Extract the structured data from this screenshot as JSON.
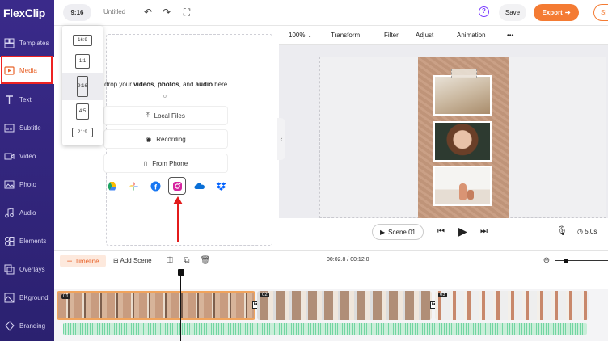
{
  "app": {
    "logo": "FlexClip"
  },
  "topbar": {
    "ratio": "9:16",
    "title": "Untitled",
    "save_label": "Save",
    "export_label": "Export",
    "signin_label": "Si"
  },
  "sidebar": {
    "items": [
      {
        "label": "Templates",
        "icon": "templates-icon"
      },
      {
        "label": "Media",
        "icon": "media-icon",
        "active": true
      },
      {
        "label": "Text",
        "icon": "text-icon"
      },
      {
        "label": "Subtitle",
        "icon": "subtitle-icon"
      },
      {
        "label": "Video",
        "icon": "video-icon"
      },
      {
        "label": "Photo",
        "icon": "photo-icon"
      },
      {
        "label": "Audio",
        "icon": "audio-icon"
      },
      {
        "label": "Elements",
        "icon": "elements-icon"
      },
      {
        "label": "Overlays",
        "icon": "overlays-icon"
      },
      {
        "label": "BKground",
        "icon": "background-icon"
      },
      {
        "label": "Branding",
        "icon": "branding-icon"
      }
    ]
  },
  "ratio_menu": {
    "options": [
      "16:9",
      "1:1",
      "9:16",
      "4:5",
      "21:9"
    ],
    "selected": "9:16"
  },
  "media": {
    "drop_prefix": "nd drop your",
    "drop_videos": "videos",
    "drop_photos": "photos",
    "drop_and": ", and",
    "drop_audio": "audio",
    "drop_suffix": "here.",
    "or": "or",
    "local_files": "Local Files",
    "recording": "Recording",
    "from_phone": "From Phone",
    "cloud_sources": [
      "google-drive-icon",
      "google-photos-icon",
      "facebook-icon",
      "instagram-icon",
      "onedrive-icon",
      "dropbox-icon"
    ]
  },
  "editor_toolbar": {
    "zoom": "100%",
    "transform": "Transform",
    "filter": "Filter",
    "adjust": "Adjust",
    "animation": "Animation",
    "more": "•••"
  },
  "player": {
    "scene": "Scene 01",
    "duration": "5.0s"
  },
  "timeline": {
    "tab": "Timeline",
    "add_scene": "Add Scene",
    "time": "00:02.8 / 00:12.0",
    "clips": [
      {
        "label": "01",
        "selected": true
      },
      {
        "label": "02"
      },
      {
        "label": "03"
      }
    ]
  },
  "colors": {
    "accent": "#f47b33",
    "sidebar": "#2b2170",
    "annotation": "#e31b1b"
  }
}
